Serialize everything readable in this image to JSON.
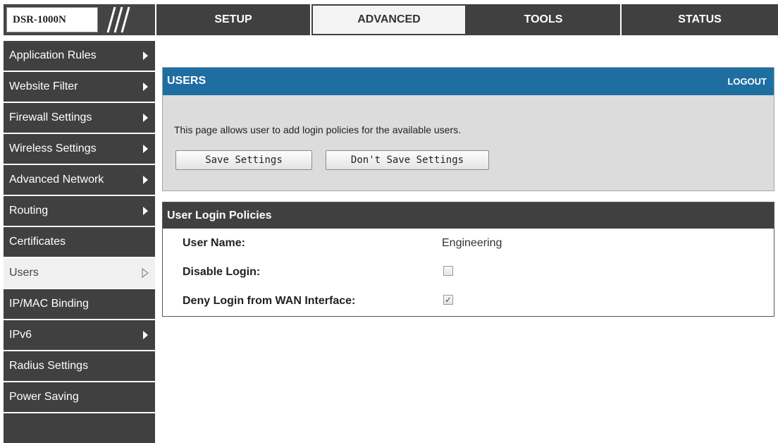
{
  "brand": {
    "model": "DSR-1000N"
  },
  "tabs": [
    {
      "label": "SETUP"
    },
    {
      "label": "ADVANCED"
    },
    {
      "label": "TOOLS"
    },
    {
      "label": "STATUS"
    }
  ],
  "active_tab": "ADVANCED",
  "sidebar": {
    "items": [
      {
        "label": "Application Rules",
        "has_submenu": true
      },
      {
        "label": "Website Filter",
        "has_submenu": true
      },
      {
        "label": "Firewall Settings",
        "has_submenu": true
      },
      {
        "label": "Wireless Settings",
        "has_submenu": true
      },
      {
        "label": "Advanced Network",
        "has_submenu": true
      },
      {
        "label": "Routing",
        "has_submenu": true
      },
      {
        "label": "Certificates",
        "has_submenu": false
      },
      {
        "label": "Users",
        "has_submenu": true,
        "active": true
      },
      {
        "label": "IP/MAC Binding",
        "has_submenu": false
      },
      {
        "label": "IPv6",
        "has_submenu": true
      },
      {
        "label": "Radius Settings",
        "has_submenu": false
      },
      {
        "label": "Power Saving",
        "has_submenu": false
      }
    ]
  },
  "users_panel": {
    "title": "USERS",
    "logout_label": "LOGOUT",
    "description": "This page allows user to add login policies for the available users.",
    "save_label": "Save Settings",
    "dont_save_label": "Don't Save Settings"
  },
  "policies_panel": {
    "title": "User Login Policies",
    "user_name_label": "User Name:",
    "user_name_value": "Engineering",
    "disable_login_label": "Disable Login:",
    "disable_login_checked": false,
    "deny_wan_label": "Deny Login from WAN Interface:",
    "deny_wan_checked": true
  },
  "colors": {
    "header_blue": "#1f6ea1",
    "dark_gray": "#404040",
    "panel_gray": "#dcdcdc"
  }
}
